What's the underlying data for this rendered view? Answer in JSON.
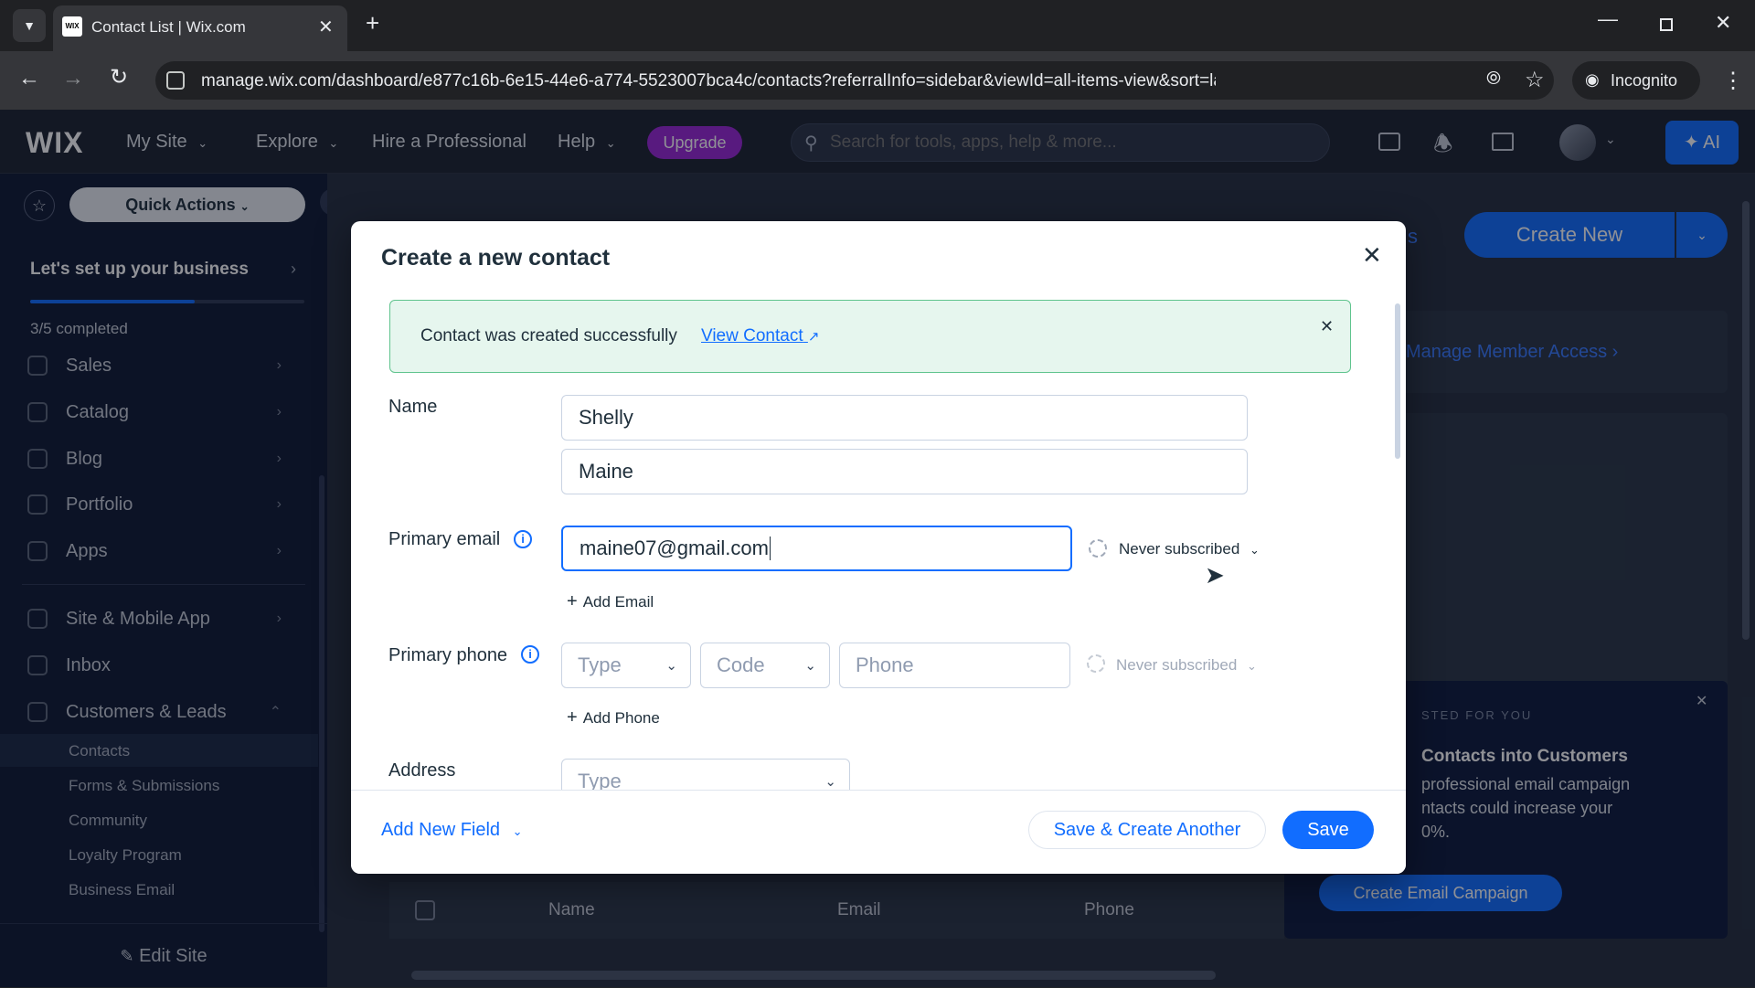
{
  "browser": {
    "tab_title": "Contact List | Wix.com",
    "tab_favicon_text": "WIX",
    "url": "manage.wix.com/dashboard/e877c16b-6e15-44e6-a774-5523007bca4c/contacts?referralInfo=sidebar&viewId=all-items-view&sort=lastActivity.date+desc&s...",
    "incognito_label": "Incognito"
  },
  "topbar": {
    "logo": "WIX",
    "my_site": "My Site",
    "explore": "Explore",
    "hire": "Hire a Professional",
    "help": "Help",
    "upgrade": "Upgrade",
    "search_placeholder": "Search for tools, apps, help & more...",
    "ai_label": "AI"
  },
  "sidebar": {
    "quick_actions": "Quick Actions",
    "setup_title": "Let's set up your business",
    "setup_progress_text": "3/5 completed",
    "setup_progress": 0.6,
    "items": [
      {
        "label": "Sales",
        "icon": "sales-icon"
      },
      {
        "label": "Catalog",
        "icon": "catalog-icon"
      },
      {
        "label": "Blog",
        "icon": "blog-icon"
      },
      {
        "label": "Portfolio",
        "icon": "portfolio-icon"
      },
      {
        "label": "Apps",
        "icon": "apps-icon"
      },
      {
        "label": "Site & Mobile App",
        "icon": "site-icon"
      },
      {
        "label": "Inbox",
        "icon": "inbox-icon"
      },
      {
        "label": "Customers & Leads",
        "icon": "customers-icon"
      }
    ],
    "subitems": [
      "Contacts",
      "Forms & Submissions",
      "Community",
      "Loyalty Program",
      "Business Email"
    ],
    "edit_site": "Edit Site"
  },
  "background_page": {
    "create_new": "Create New",
    "partial_link": "s",
    "manage_member_access": "Manage Member Access",
    "promo_eyebrow": "STED FOR YOU",
    "promo_title": "Contacts into Customers",
    "promo_body": "professional email campaign\nntacts could increase your\n0%.",
    "promo_button": "Create Email Campaign",
    "table_headers": [
      "Name",
      "Email",
      "Phone"
    ]
  },
  "modal": {
    "title": "Create a new contact",
    "banner_text": "Contact was created successfully",
    "banner_link": "View Contact",
    "name_label": "Name",
    "first_name": "Shelly",
    "last_name": "Maine",
    "email_label": "Primary email",
    "email_value": "maine07@gmail.com",
    "email_subscription": "Never subscribed",
    "add_email": "Add Email",
    "phone_label": "Primary phone",
    "phone_type_placeholder": "Type",
    "phone_code_placeholder": "Code",
    "phone_placeholder": "Phone",
    "phone_subscription": "Never subscribed",
    "add_phone": "Add Phone",
    "address_label": "Address",
    "address_type_placeholder": "Type",
    "add_new_field": "Add New Field",
    "save_create_another": "Save & Create Another",
    "save": "Save"
  },
  "colors": {
    "accent": "#116dff",
    "success_bg": "#e6f6ee",
    "success_border": "#60c48e",
    "upgrade": "#9a27d5",
    "sidebar_bg": "#0f1b33"
  }
}
